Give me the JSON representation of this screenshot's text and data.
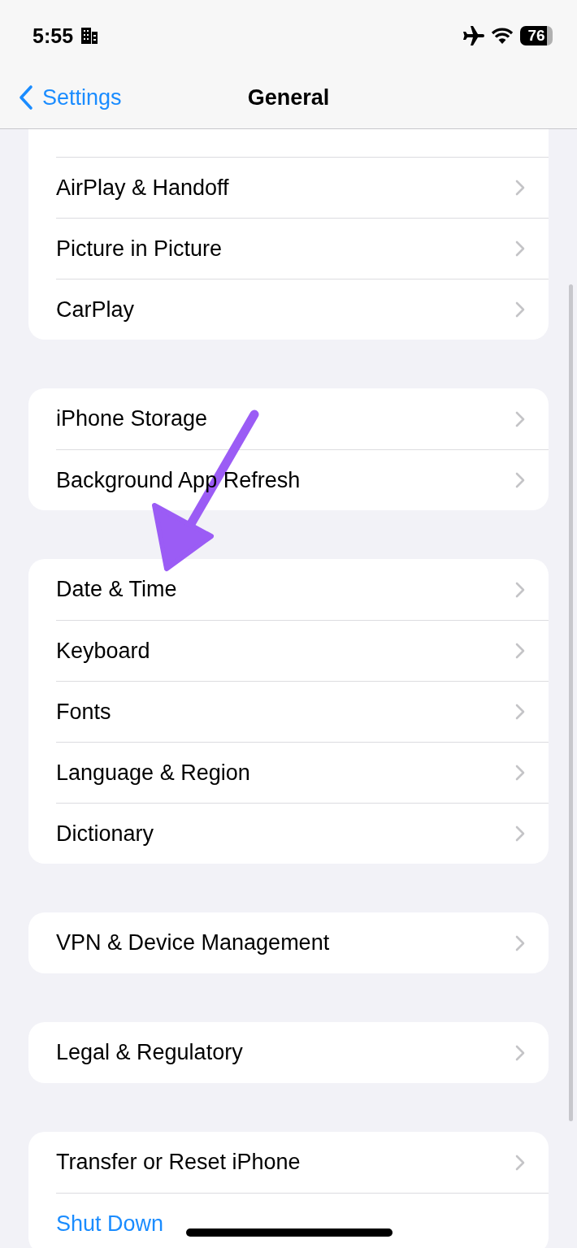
{
  "status_bar": {
    "time": "5:55",
    "battery": "76"
  },
  "nav": {
    "back": "Settings",
    "title": "General"
  },
  "groups": [
    {
      "rows": [
        {
          "label": "AirPlay & Handoff",
          "kind": "link"
        },
        {
          "label": "Picture in Picture",
          "kind": "link"
        },
        {
          "label": "CarPlay",
          "kind": "link"
        }
      ]
    },
    {
      "rows": [
        {
          "label": "iPhone Storage",
          "kind": "link"
        },
        {
          "label": "Background App Refresh",
          "kind": "link"
        }
      ]
    },
    {
      "rows": [
        {
          "label": "Date & Time",
          "kind": "link"
        },
        {
          "label": "Keyboard",
          "kind": "link"
        },
        {
          "label": "Fonts",
          "kind": "link"
        },
        {
          "label": "Language & Region",
          "kind": "link"
        },
        {
          "label": "Dictionary",
          "kind": "link"
        }
      ]
    },
    {
      "rows": [
        {
          "label": "VPN & Device Management",
          "kind": "link"
        }
      ]
    },
    {
      "rows": [
        {
          "label": "Legal & Regulatory",
          "kind": "link"
        }
      ]
    },
    {
      "rows": [
        {
          "label": "Transfer or Reset iPhone",
          "kind": "link"
        },
        {
          "label": "Shut Down",
          "kind": "action"
        }
      ]
    }
  ]
}
